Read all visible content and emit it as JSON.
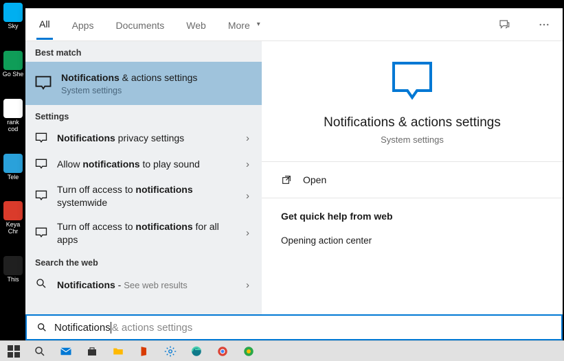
{
  "desktop_icons": [
    {
      "label": "Sky"
    },
    {
      "label": "Go She"
    },
    {
      "label": "rank cod"
    },
    {
      "label": "Tele"
    },
    {
      "label": "Keya Chr"
    },
    {
      "label": "This"
    }
  ],
  "tabs": {
    "items": [
      "All",
      "Apps",
      "Documents",
      "Web",
      "More"
    ],
    "active": "All"
  },
  "left": {
    "best_match_header": "Best match",
    "best_match": {
      "title_bold": "Notifications",
      "title_rest": " & actions settings",
      "subtitle": "System settings"
    },
    "settings_header": "Settings",
    "settings": [
      {
        "pre": "",
        "bold": "Notifications",
        "post": " privacy settings"
      },
      {
        "pre": "Allow ",
        "bold": "notifications",
        "post": " to play sound"
      },
      {
        "pre": "Turn off access to ",
        "bold": "notifications",
        "post": " systemwide"
      },
      {
        "pre": "Turn off access to ",
        "bold": "notifications",
        "post": " for all apps"
      }
    ],
    "web_header": "Search the web",
    "web": {
      "bold": "Notifications",
      "rest": " - ",
      "hint": "See web results"
    }
  },
  "preview": {
    "title": "Notifications & actions settings",
    "subtitle": "System settings",
    "open_label": "Open",
    "help_header": "Get quick help from web",
    "help_items": [
      "Opening action center"
    ]
  },
  "searchbox": {
    "typed": "Notifications",
    "ghost": " & actions settings"
  },
  "icons": {
    "chevron": "›"
  }
}
